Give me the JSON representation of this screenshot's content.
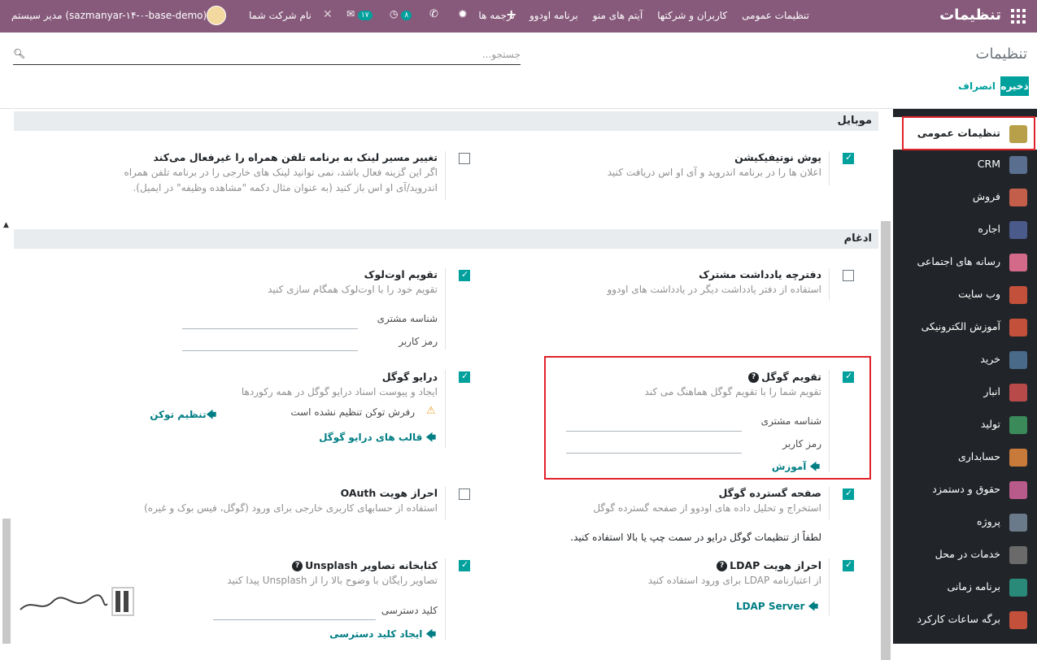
{
  "topbar": {
    "brand": "تنظیمات",
    "menu": [
      "تنظیمات عمومی",
      "کاربران و شرکتها",
      "آیتم های منو",
      "برنامه اودوو",
      "ترجمه ها"
    ],
    "activity_count": "۸",
    "message_count": "۱۷",
    "company": "نام شرکت شما",
    "user": "مدیر سیستم",
    "db": "(sazmanyar-۱۴-۰-base-demo)"
  },
  "control": {
    "breadcrumb": "تنظیمات",
    "search_placeholder": "جستجو...",
    "save": "ذخیره",
    "cancel": "انصراف"
  },
  "sidebar": {
    "items": [
      {
        "label": "تنظیمات عمومی",
        "icon": "gear-icon",
        "color": "#b8a04a"
      },
      {
        "label": "CRM",
        "icon": "handshake-icon",
        "color": "#5a6f8f"
      },
      {
        "label": "فروش",
        "icon": "chart-icon",
        "color": "#c25e4a"
      },
      {
        "label": "اجاره",
        "icon": "calendar-icon",
        "color": "#4a5a8a"
      },
      {
        "label": "رسانه های اجتماعی",
        "icon": "thumbs-up-icon",
        "color": "#d46a8a"
      },
      {
        "label": "وب سایت",
        "icon": "globe-icon",
        "color": "#c2503a"
      },
      {
        "label": "آموزش الکترونیکی",
        "icon": "presentation-icon",
        "color": "#c2503a"
      },
      {
        "label": "خرید",
        "icon": "card-icon",
        "color": "#4a6a8a"
      },
      {
        "label": "انبار",
        "icon": "box-icon",
        "color": "#b84a4a"
      },
      {
        "label": "تولید",
        "icon": "wrench-icon",
        "color": "#3a8a5a"
      },
      {
        "label": "حسابداری",
        "icon": "invoice-icon",
        "color": "#c87a3a"
      },
      {
        "label": "حقوق و دستمزد",
        "icon": "people-icon",
        "color": "#b85a8a"
      },
      {
        "label": "پروژه",
        "icon": "puzzle-icon",
        "color": "#6a7a8a"
      },
      {
        "label": "خدمات در محل",
        "icon": "tools-icon",
        "color": "#6a6a6a"
      },
      {
        "label": "برنامه زمانی",
        "icon": "list-icon",
        "color": "#2a8a7a"
      },
      {
        "label": "برگه ساعات کارکرد",
        "icon": "stopwatch-icon",
        "color": "#c2503a"
      }
    ]
  },
  "sections": {
    "mobile": "موبایل",
    "integration": "ادغام"
  },
  "settings": {
    "push": {
      "title": "پوش نوتیفیکیشن",
      "desc": "اعلان ها را در برنامه اندروید و آی او اس دریافت کنید",
      "checked": true
    },
    "link": {
      "title": "تغییر مسیر لینک به برنامه تلفن همراه را غیرفعال می‌کند",
      "desc": "اگر این گزینه فعال باشد، نمی توانید لینک های خارجی را در برنامه تلفن همراه اندروید/آی او اس باز کنید (به عنوان مثال دکمه \"مشاهده وظیفه\" در ایمیل).",
      "checked": false
    },
    "notes": {
      "title": "دفترچه یادداشت مشترک",
      "desc": "استفاده از دفتر یادداشت دیگر در یادداشت های اودوو",
      "checked": false
    },
    "outlook": {
      "title": "تقویم اوت‌لوک",
      "desc": "تقویم خود را با اوت‌لوک همگام سازی کنید",
      "checked": true,
      "client_id": "شناسه مشتری",
      "secret": "رمز کاربر"
    },
    "gcal": {
      "title": "تقویم گوگل",
      "desc": "تقویم شما را با تقویم گوگل هماهنگ می کند",
      "checked": true,
      "client_id": "شناسه مشتری",
      "secret": "رمز کاربر",
      "link": "آموزش"
    },
    "gdrive": {
      "title": "درایو گوگل",
      "desc": "ایجاد و پیوست اسناد درایو گوگل در همه رکوردها",
      "checked": true,
      "warning": "رفرش توکن تنظیم نشده است",
      "token_link": "تنظیم توکن",
      "templates_link": "قالب های درایو گوگل"
    },
    "gsheet": {
      "title": "صفحه گسترده گوگل",
      "desc": "استخراج و تحلیل داده های اودوو از صفحه گسترده گوگل",
      "checked": true,
      "note": "لطفاً از تنظیمات گوگل درایو در سمت چپ یا بالا استفاده کنید."
    },
    "oauth": {
      "title": "احراز هویت OAuth",
      "desc": "استفاده از حسابهای کاربری خارجی برای ورود (گوگل، فیس بوک و غیره)",
      "checked": false
    },
    "ldap": {
      "title": "احراز هویت LDAP",
      "desc": "از اعتبارنامه LDAP برای ورود استفاده کنید",
      "checked": true,
      "link": "LDAP Server"
    },
    "unsplash": {
      "title": "کتابخانه تصاویر Unsplash",
      "desc": "تصاویر رایگان با وضوح بالا را از Unsplash پیدا کنید",
      "checked": true,
      "key_label": "کلید دسترسی",
      "link": "ایجاد کلید دسترسی"
    }
  },
  "watermark": "تسهیل‌گستر"
}
